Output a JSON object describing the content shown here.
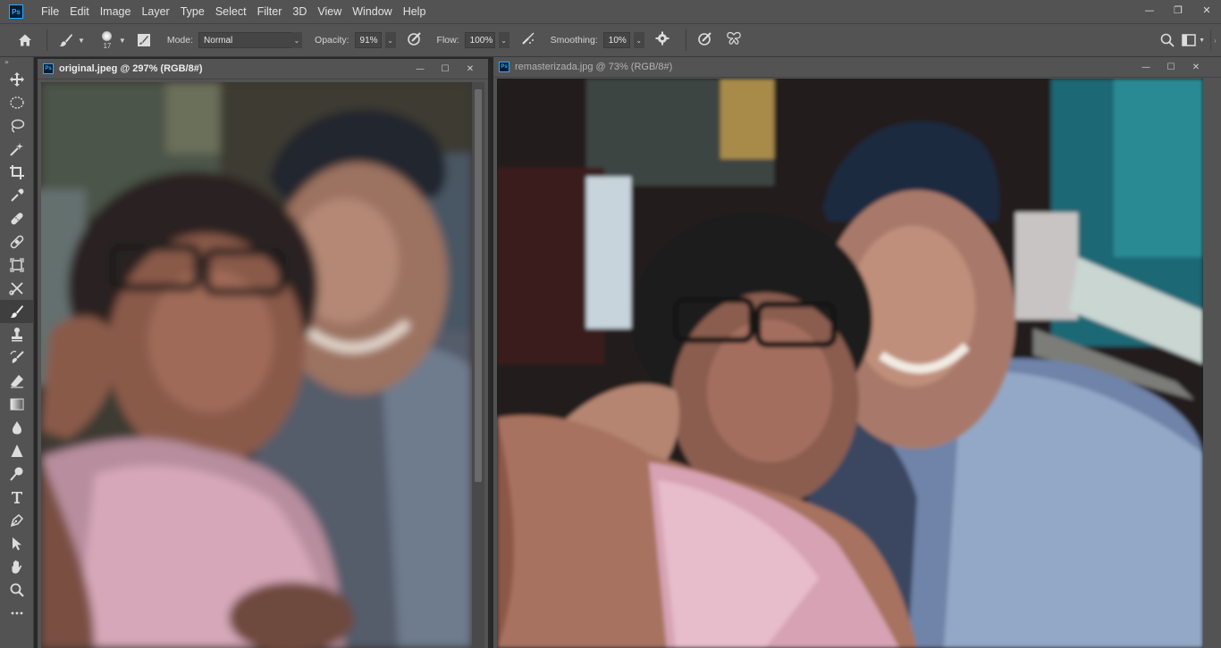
{
  "app": {
    "logo_text": "Ps"
  },
  "menu": [
    "File",
    "Edit",
    "Image",
    "Layer",
    "Type",
    "Select",
    "Filter",
    "3D",
    "View",
    "Window",
    "Help"
  ],
  "window_controls": {
    "minimize": "—",
    "restore": "❐",
    "close": "✕"
  },
  "options": {
    "brush_size": "17",
    "mode_label": "Mode:",
    "mode_value": "Normal",
    "opacity_label": "Opacity:",
    "opacity_value": "91%",
    "flow_label": "Flow:",
    "flow_value": "100%",
    "smoothing_label": "Smoothing:",
    "smoothing_value": "10%"
  },
  "documents": [
    {
      "title": "original.jpeg @ 297% (RGB/8#)",
      "active": true
    },
    {
      "title": "remasterizada.jpg @ 73% (RGB/8#)",
      "active": false
    }
  ],
  "tools": [
    "move-tool",
    "marquee-tool",
    "lasso-tool",
    "magic-wand-tool",
    "crop-tool",
    "eyedropper-tool",
    "spot-healing-tool",
    "healing-patch-tool",
    "frame-tool",
    "puppet-warp-tool",
    "brush-tool",
    "clone-stamp-tool",
    "history-brush-tool",
    "eraser-tool",
    "gradient-tool",
    "blur-tool",
    "sharpen-tool",
    "dodge-tool",
    "type-tool",
    "pen-tool",
    "path-selection-tool",
    "hand-tool",
    "zoom-tool",
    "more-tools"
  ],
  "active_tool": "brush-tool",
  "colors": {
    "ui_bg": "#535353",
    "ps_blue": "#31a8ff",
    "ps_dark": "#001e36"
  }
}
